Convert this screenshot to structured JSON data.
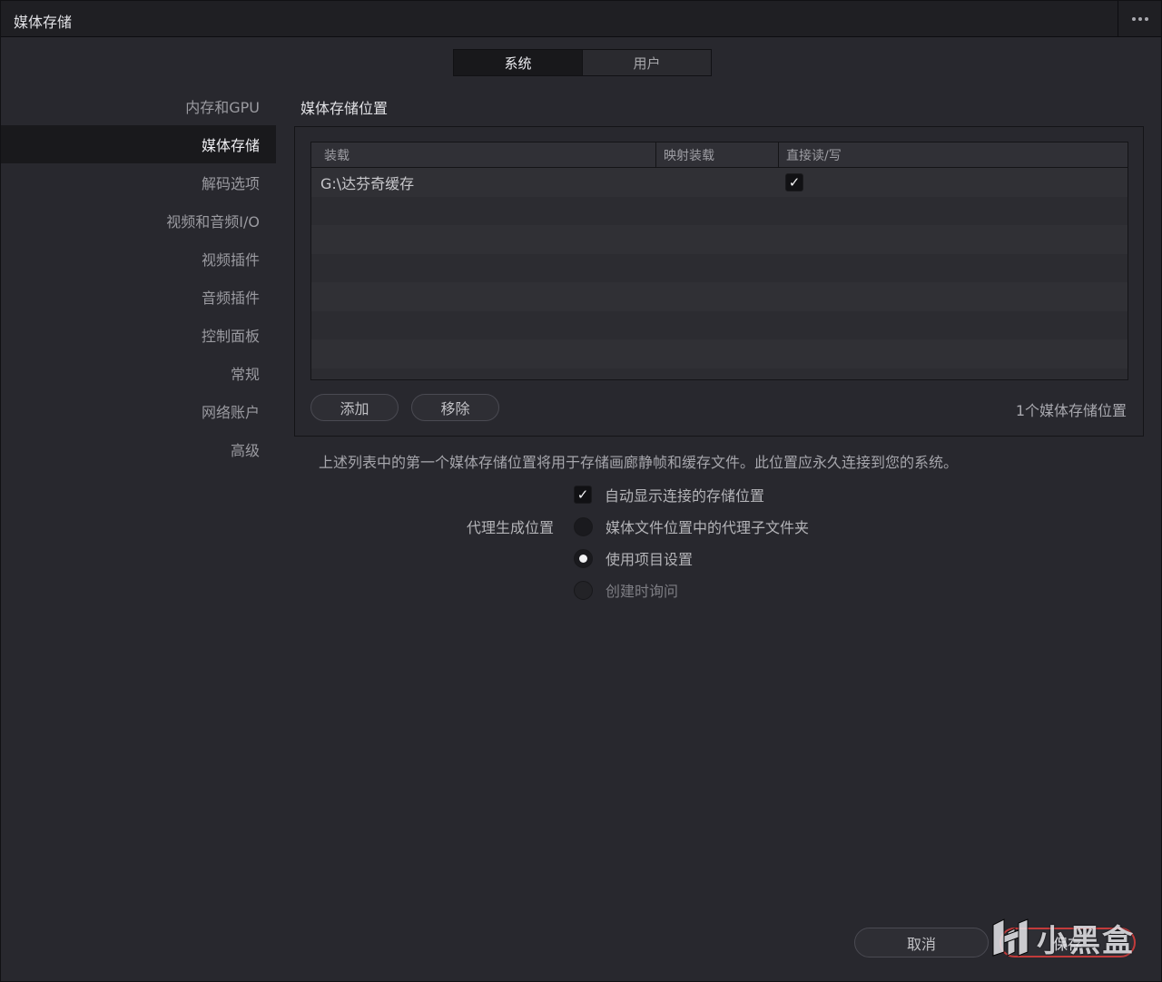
{
  "window": {
    "title": "媒体存储"
  },
  "tabs": [
    {
      "label": "系统",
      "active": true
    },
    {
      "label": "用户",
      "active": false
    }
  ],
  "sidebar": {
    "items": [
      {
        "label": "内存和GPU"
      },
      {
        "label": "媒体存储",
        "active": true
      },
      {
        "label": "解码选项"
      },
      {
        "label": "视频和音频I/O"
      },
      {
        "label": "视频插件"
      },
      {
        "label": "音频插件"
      },
      {
        "label": "控制面板"
      },
      {
        "label": "常规"
      },
      {
        "label": "网络账户"
      },
      {
        "label": "高级"
      }
    ]
  },
  "main": {
    "section_title": "媒体存储位置",
    "table": {
      "columns": [
        "装载",
        "映射装载",
        "直接读/写"
      ],
      "rows": [
        {
          "mount": "G:\\达芬奇缓存",
          "mapped": "",
          "direct_rw": true
        }
      ]
    },
    "add_label": "添加",
    "remove_label": "移除",
    "count_label": "1个媒体存储位置",
    "note": "上述列表中的第一个媒体存储位置将用于存储画廊静帧和缓存文件。此位置应永久连接到您的系统。",
    "auto_show_label": "自动显示连接的存储位置",
    "auto_show_checked": true,
    "proxy_label": "代理生成位置",
    "proxy_options": [
      {
        "label": "媒体文件位置中的代理子文件夹",
        "selected": false
      },
      {
        "label": "使用项目设置",
        "selected": true
      },
      {
        "label": "创建时询问",
        "selected": false
      }
    ]
  },
  "footer": {
    "cancel_label": "取消",
    "save_label": "保存"
  },
  "watermark": {
    "text": "小黑盒"
  },
  "colors": {
    "accent_save_border": "#c23b3b",
    "background": "#28282e",
    "titlebar": "#1f1f23"
  }
}
